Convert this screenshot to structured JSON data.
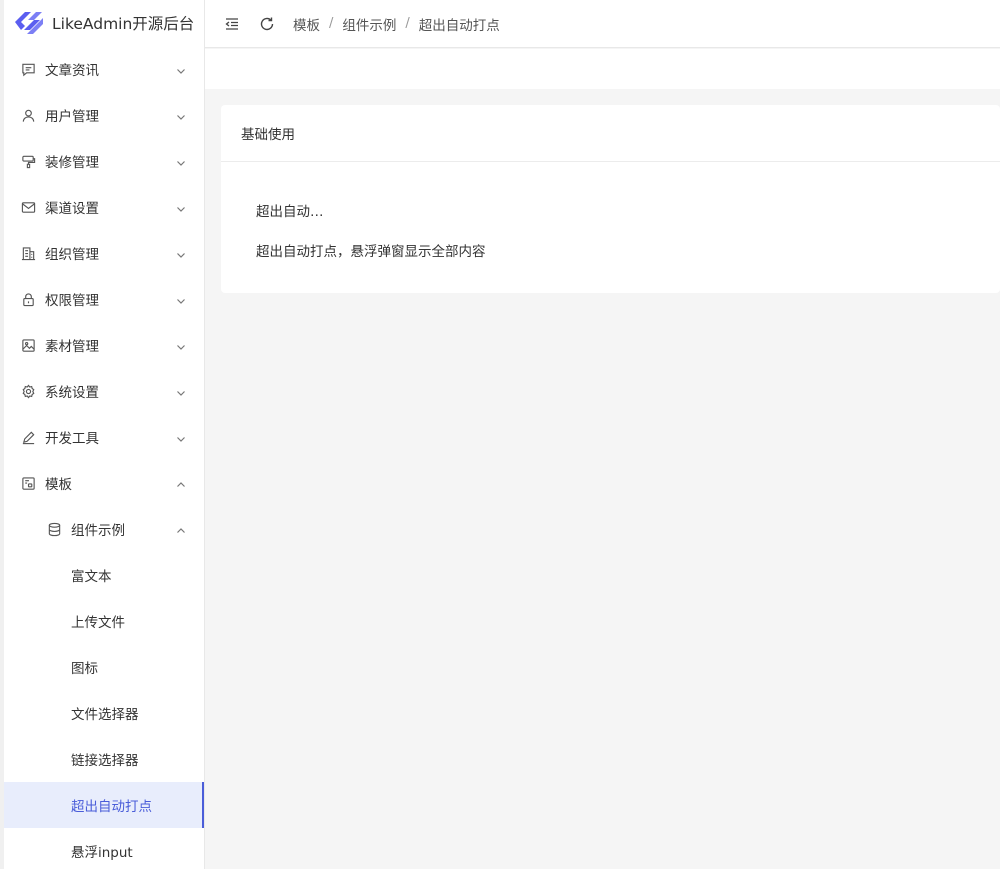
{
  "app": {
    "title": "LikeAdmin开源后台"
  },
  "colors": {
    "accent": "#4a5dd9",
    "logo": "#5b5ef0",
    "active_bg": "#e8edfc"
  },
  "sidebar": {
    "items": [
      {
        "label": "文章资讯",
        "icon": "message-square-icon"
      },
      {
        "label": "用户管理",
        "icon": "user-icon"
      },
      {
        "label": "装修管理",
        "icon": "brush-icon"
      },
      {
        "label": "渠道设置",
        "icon": "mail-icon"
      },
      {
        "label": "组织管理",
        "icon": "building-icon"
      },
      {
        "label": "权限管理",
        "icon": "lock-icon"
      },
      {
        "label": "素材管理",
        "icon": "image-icon"
      },
      {
        "label": "系统设置",
        "icon": "gear-icon"
      },
      {
        "label": "开发工具",
        "icon": "pen-icon"
      },
      {
        "label": "模板",
        "icon": "template-icon"
      }
    ],
    "submenu": {
      "label": "组件示例",
      "icon": "database-icon"
    },
    "subitems": [
      {
        "label": "富文本"
      },
      {
        "label": "上传文件"
      },
      {
        "label": "图标"
      },
      {
        "label": "文件选择器"
      },
      {
        "label": "链接选择器"
      },
      {
        "label": "超出自动打点"
      },
      {
        "label": "悬浮input"
      }
    ]
  },
  "header": {
    "breadcrumb": [
      "模板",
      "组件示例",
      "超出自动打点"
    ],
    "separator": "/"
  },
  "card": {
    "title": "基础使用",
    "ellipsis_text": "超出自动打点，悬浮弹窗显示全部内容",
    "full_text": "超出自动打点，悬浮弹窗显示全部内容"
  }
}
